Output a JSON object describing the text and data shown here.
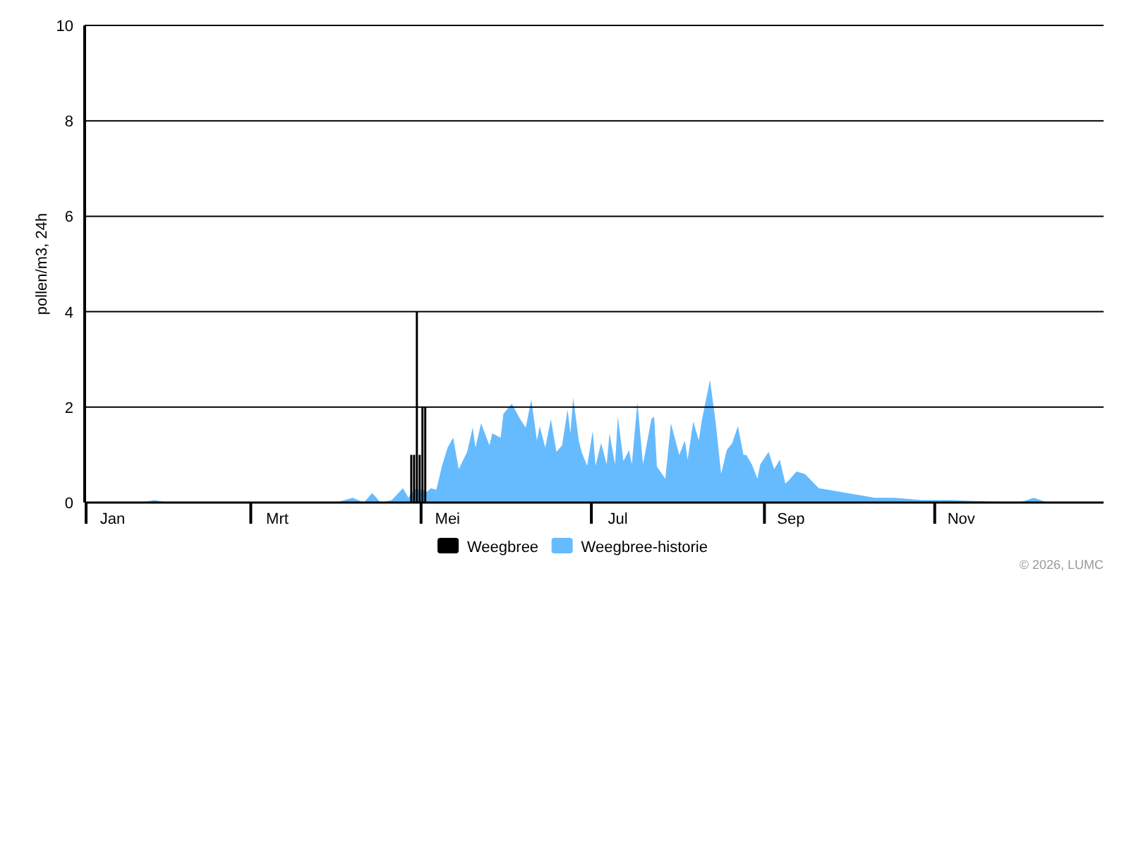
{
  "chart": {
    "chart_data": {
      "type": "area",
      "grid": true,
      "legend": "bottom",
      "ylabel": "pollen/m3, 24h",
      "xlim": [
        "2026-01-01",
        "2027-01-01"
      ],
      "ylim": [
        0,
        10
      ],
      "yticks": [
        0,
        2,
        4,
        6,
        8,
        10
      ],
      "xticks": [
        {
          "value": "2026-01-11",
          "label": "Jan"
        },
        {
          "value": "2026-03-11",
          "label": "Mrt"
        },
        {
          "value": "2026-05-11",
          "label": "Mei"
        },
        {
          "value": "2026-07-11",
          "label": "Jul"
        },
        {
          "value": "2026-09-11",
          "label": "Sep"
        },
        {
          "value": "2026-11-11",
          "label": "Nov"
        }
      ],
      "x": [
        "2026-01-01",
        "2026-01-21",
        "2026-01-26",
        "2026-01-31",
        "2026-04-01",
        "2026-04-07",
        "2026-04-11",
        "2026-04-14",
        "2026-04-17",
        "2026-04-21",
        "2026-04-25",
        "2026-04-27",
        "2026-04-28",
        "2026-04-29",
        "2026-04-30",
        "2026-05-01",
        "2026-05-02",
        "2026-05-03",
        "2026-05-05",
        "2026-05-07",
        "2026-05-09",
        "2026-05-11",
        "2026-05-13",
        "2026-05-15",
        "2026-05-18",
        "2026-05-20",
        "2026-05-21",
        "2026-05-23",
        "2026-05-26",
        "2026-05-27",
        "2026-05-30",
        "2026-05-31",
        "2026-06-03",
        "2026-06-06",
        "2026-06-08",
        "2026-06-10",
        "2026-06-12",
        "2026-06-13",
        "2026-06-15",
        "2026-06-17",
        "2026-06-19",
        "2026-06-21",
        "2026-06-23",
        "2026-06-24",
        "2026-06-25",
        "2026-06-27",
        "2026-06-28",
        "2026-06-30",
        "2026-07-02",
        "2026-07-03",
        "2026-07-05",
        "2026-07-07",
        "2026-07-08",
        "2026-07-10",
        "2026-07-11",
        "2026-07-13",
        "2026-07-15",
        "2026-07-16",
        "2026-07-18",
        "2026-07-20",
        "2026-07-23",
        "2026-07-24",
        "2026-07-25",
        "2026-07-28",
        "2026-07-30",
        "2026-08-02",
        "2026-08-04",
        "2026-08-05",
        "2026-08-07",
        "2026-08-09",
        "2026-08-10",
        "2026-08-13",
        "2026-08-15",
        "2026-08-17",
        "2026-08-19",
        "2026-08-21",
        "2026-08-23",
        "2026-08-25",
        "2026-08-26",
        "2026-08-28",
        "2026-08-30",
        "2026-08-31",
        "2026-09-03",
        "2026-09-05",
        "2026-09-07",
        "2026-09-09",
        "2026-09-10",
        "2026-09-13",
        "2026-09-16",
        "2026-09-21",
        "2026-09-26",
        "2026-10-01",
        "2026-10-06",
        "2026-10-11",
        "2026-10-18",
        "2026-10-28",
        "2026-11-07",
        "2026-11-17",
        "2026-12-02",
        "2026-12-07",
        "2026-12-12",
        "2026-12-31"
      ],
      "series": [
        {
          "name": "Weegbree",
          "color": "#000000",
          "type": "bar",
          "x": [
            "2026-04-28",
            "2026-04-29",
            "2026-04-30",
            "2026-05-01",
            "2026-05-02",
            "2026-05-03"
          ],
          "values": [
            1,
            1,
            4,
            1,
            2,
            2
          ]
        },
        {
          "name": "Weegbree-historie",
          "color": "#66bbff",
          "values": [
            0,
            0,
            0.05,
            0,
            0,
            0.1,
            0,
            0.2,
            0,
            0.05,
            0.3,
            0.1,
            0.2,
            0.25,
            0.3,
            0.25,
            0.3,
            0.2,
            0.3,
            0.27,
            0.77,
            1.15,
            1.36,
            0.7,
            1.06,
            1.57,
            1.15,
            1.66,
            1.2,
            1.45,
            1.36,
            1.86,
            2.07,
            1.75,
            1.57,
            2.16,
            1.3,
            1.6,
            1.15,
            1.75,
            1.06,
            1.2,
            1.95,
            1.45,
            2.2,
            1.3,
            1.06,
            0.77,
            1.5,
            0.77,
            1.25,
            0.8,
            1.45,
            0.8,
            1.8,
            0.87,
            1.1,
            0.8,
            2.1,
            0.8,
            1.75,
            1.8,
            0.75,
            0.5,
            1.66,
            1.0,
            1.3,
            0.9,
            1.7,
            1.3,
            1.7,
            2.57,
            1.7,
            0.6,
            1.1,
            1.25,
            1.6,
            1.0,
            1.0,
            0.8,
            0.5,
            0.8,
            1.06,
            0.7,
            0.9,
            0.4,
            0.45,
            0.65,
            0.6,
            0.3,
            0.25,
            0.2,
            0.15,
            0.1,
            0.1,
            0.05,
            0.05,
            0.03,
            0,
            0.1,
            0,
            0
          ]
        }
      ]
    },
    "credit": "© 2026, LUMC"
  }
}
